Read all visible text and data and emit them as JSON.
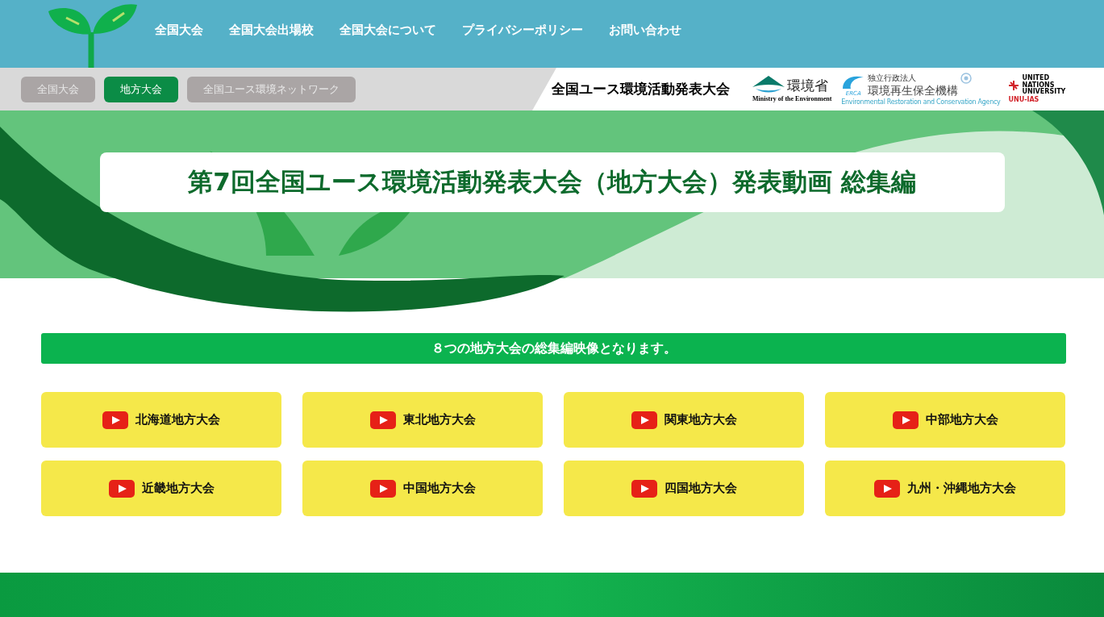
{
  "nav": {
    "items": [
      {
        "label": "全国大会"
      },
      {
        "label": "全国大会出場校"
      },
      {
        "label": "全国大会について"
      },
      {
        "label": "プライバシーポリシー"
      },
      {
        "label": "お問い合わせ"
      }
    ]
  },
  "subnav": {
    "tabs": [
      {
        "label": "全国大会",
        "selected": false
      },
      {
        "label": "地方大会",
        "selected": true
      },
      {
        "label": "全国ユース環境ネットワーク",
        "selected": false
      }
    ],
    "site_title": "全国ユース環境活動発表大会",
    "logos": {
      "moe": {
        "name": "環境省",
        "english": "Ministry of the Environment"
      },
      "erca": {
        "prefix": "独立行政法人",
        "name": "環境再生保全機構",
        "abbr": "ERCA",
        "english": "Environmental Restoration and Conservation Agency"
      },
      "unu": {
        "name": "UNITED NATIONS UNIVERSITY",
        "abbr": "UNU-IAS"
      }
    }
  },
  "hero": {
    "title": "第7回全国ユース環境活動発表大会（地方大会）発表動画 総集編"
  },
  "intro": "８つの地方大会の総集編映像となります。",
  "videos": [
    {
      "label": "北海道地方大会"
    },
    {
      "label": "東北地方大会"
    },
    {
      "label": "関東地方大会"
    },
    {
      "label": "中部地方大会"
    },
    {
      "label": "近畿地方大会"
    },
    {
      "label": "中国地方大会"
    },
    {
      "label": "四国地方大会"
    },
    {
      "label": "九州・沖縄地方大会"
    }
  ]
}
